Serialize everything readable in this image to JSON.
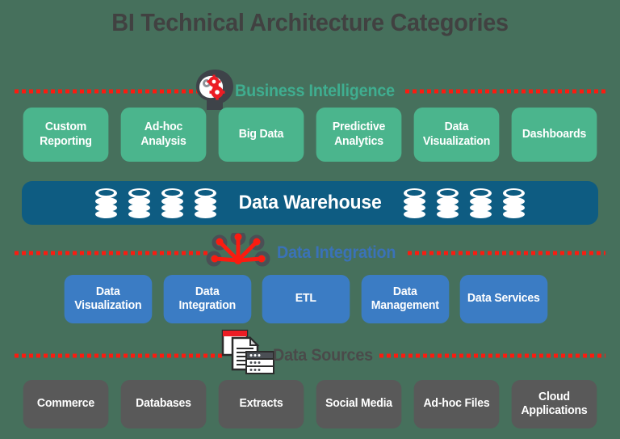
{
  "page": {
    "title": "BI Technical Architecture Categories",
    "background_color": "#46705c",
    "title_color": "#414141"
  },
  "sections": [
    {
      "id": "business-intelligence",
      "divider_label": "Business Intelligence",
      "divider_label_color": "#3fae90",
      "divider_line_color": "#fb1b10",
      "icon": "brain-gears-icon",
      "card_color": "#4bb58d",
      "cards": [
        "Custom Reporting",
        "Ad-hoc Analysis",
        "Big Data",
        "Predictive Analytics",
        "Data Visualization",
        "Dashboards"
      ]
    },
    {
      "id": "data-integration",
      "divider_label": "Data Integration",
      "divider_label_color": "#3a72b8",
      "divider_line_color": "#fb1b10",
      "icon": "integration-node-icon",
      "card_color": "#3b7cc4",
      "cards": [
        "Data Visualization",
        "Data Integration",
        "ETL",
        "Data Management",
        "Data Services"
      ]
    },
    {
      "id": "data-sources",
      "divider_label": "Data Sources",
      "divider_label_color": "#4a4a4a",
      "divider_line_color": "#fb1b10",
      "icon": "documents-server-icon",
      "card_color": "#595959",
      "cards": [
        "Commerce",
        "Databases",
        "Extracts",
        "Social Media",
        "Ad-hoc Files",
        "Cloud Applications"
      ]
    }
  ],
  "data_warehouse": {
    "label": "Data Warehouse",
    "band_color": "#0e5c82",
    "icon": "database-cylinder-icon",
    "icons_left_count": 4,
    "icons_right_count": 4
  }
}
